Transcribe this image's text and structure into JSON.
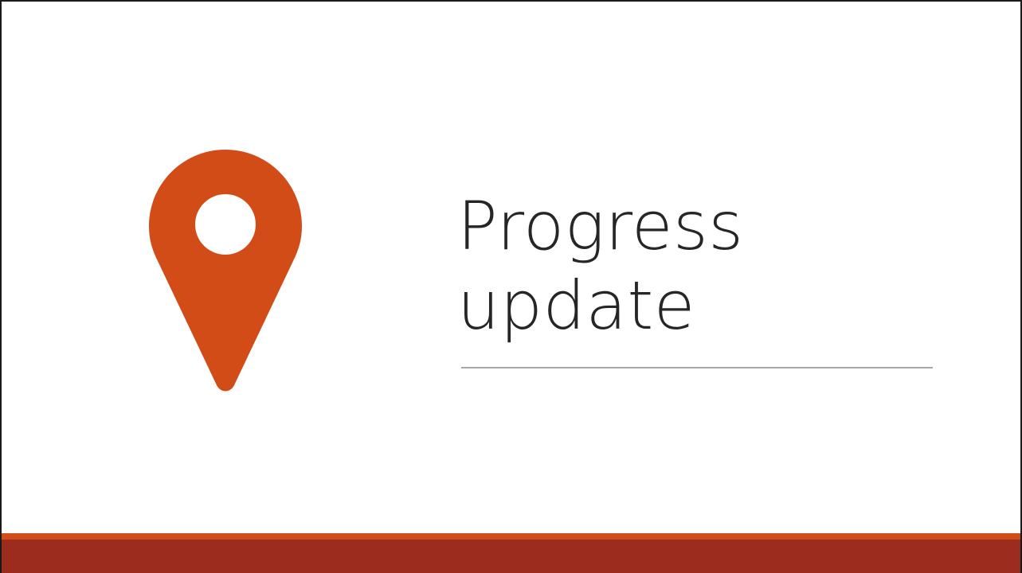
{
  "slide": {
    "title_line1": "Progress",
    "title_line2": "update"
  },
  "icons": {
    "pin": "location-pin-icon"
  },
  "colors": {
    "accent": "#d24c18",
    "footer": "#9b2c1e",
    "title_text": "#262626",
    "rule": "#a6a6a6"
  }
}
